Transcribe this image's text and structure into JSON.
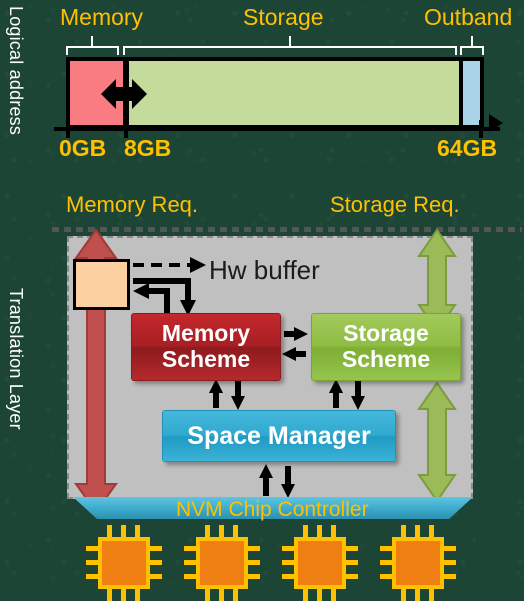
{
  "figure": {
    "background_color": "#1d4536",
    "accent_label_color": "#FFC000"
  },
  "side_labels": {
    "logical_address": "Logical address",
    "translation_layer": "Translation Layer"
  },
  "address_map": {
    "regions": [
      {
        "name": "Memory",
        "label": "Memory",
        "color": "#f97c82",
        "start": "0GB",
        "end": "8GB"
      },
      {
        "name": "Storage",
        "label": "Storage",
        "color": "#c5db9b",
        "start": "8GB",
        "end": "64GB"
      },
      {
        "name": "Outband",
        "label": "Outband",
        "color": "#a8d3e8",
        "start": "64GB",
        "end": "64GB"
      }
    ],
    "tick_labels": [
      "0GB",
      "8GB",
      "64GB"
    ],
    "boundary_arrow": "resizable-memory-storage-boundary"
  },
  "requests": {
    "memory": "Memory Req.",
    "storage": "Storage Req."
  },
  "translation_layer": {
    "hw_buffer_label": "Hw buffer",
    "blocks": [
      {
        "id": "memory-scheme",
        "label": "Memory\nScheme",
        "line1": "Memory",
        "line2": "Scheme",
        "color": "#a81f23"
      },
      {
        "id": "storage-scheme",
        "label": "Storage\nScheme",
        "line1": "Storage",
        "line2": "Scheme",
        "color": "#8fbd43"
      },
      {
        "id": "space-manager",
        "label": "Space Manager",
        "color": "#31a9d0"
      }
    ],
    "memory_scheme_line1": "Memory",
    "memory_scheme_line2": "Scheme",
    "storage_scheme_line1": "Storage",
    "storage_scheme_line2": "Scheme",
    "space_manager_label": "Space Manager"
  },
  "hardware": {
    "nvm_controller_label": "NVM Chip Controller",
    "chip_count": 4,
    "chip_color": "#ef7f12",
    "chip_border_color": "#FFC000"
  }
}
